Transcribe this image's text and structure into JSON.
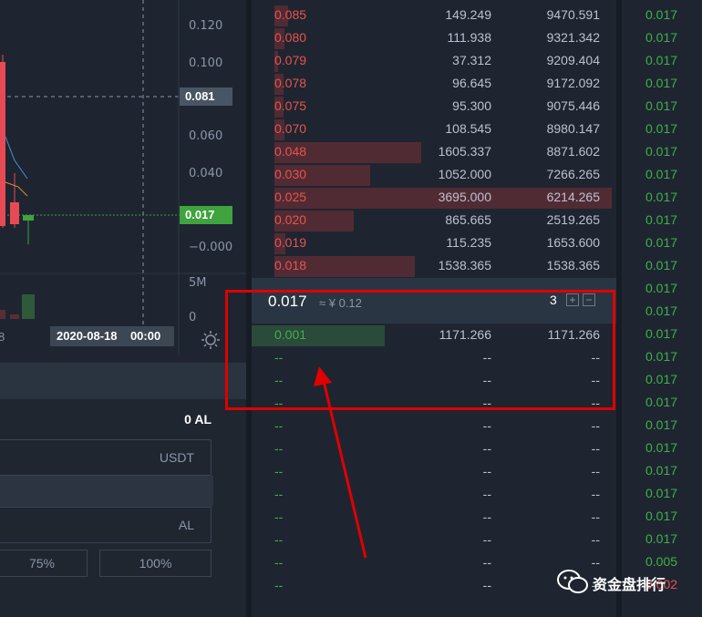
{
  "chart": {
    "y_axis_ticks": [
      "0.120",
      "0.100",
      "0.060",
      "0.040",
      "−0.000"
    ],
    "volume_ticks": [
      "5M",
      "0"
    ],
    "price_tag_last": "0.081",
    "price_tag_current": "0.017",
    "x_date_label": "2020-08-18    00:00",
    "x_partial_label": "8",
    "settings_icon": "gear-icon",
    "colors": {
      "up": "#3fa33f",
      "down": "#e84a55"
    }
  },
  "order_form": {
    "available": "0 AL",
    "price_unit": "USDT",
    "amount_unit": "AL",
    "percent_buttons": [
      "75%",
      "100%"
    ]
  },
  "order_book": {
    "asks": [
      {
        "price": "0.085",
        "amount": "149.249",
        "total": "9470.591"
      },
      {
        "price": "0.080",
        "amount": "111.938",
        "total": "9321.342"
      },
      {
        "price": "0.079",
        "amount": "37.312",
        "total": "9209.404"
      },
      {
        "price": "0.078",
        "amount": "96.645",
        "total": "9172.092"
      },
      {
        "price": "0.075",
        "amount": "95.300",
        "total": "9075.446"
      },
      {
        "price": "0.070",
        "amount": "108.545",
        "total": "8980.147"
      },
      {
        "price": "0.048",
        "amount": "1605.337",
        "total": "8871.602"
      },
      {
        "price": "0.030",
        "amount": "1052.000",
        "total": "7266.265"
      },
      {
        "price": "0.025",
        "amount": "3695.000",
        "total": "6214.265"
      },
      {
        "price": "0.020",
        "amount": "865.665",
        "total": "2519.265"
      },
      {
        "price": "0.019",
        "amount": "115.235",
        "total": "1653.600"
      },
      {
        "price": "0.018",
        "amount": "1538.365",
        "total": "1538.365"
      }
    ],
    "last_price": "0.017",
    "last_price_cny": "≈ ¥ 0.12",
    "depth_level": "3",
    "depth_plus": "+",
    "depth_minus": "−",
    "bids": [
      {
        "price": "0.001",
        "amount": "1171.266",
        "total": "1171.266"
      }
    ],
    "empty_placeholder": "--",
    "empty_rows": 11
  },
  "trades": [
    "0.017",
    "0.017",
    "0.017",
    "0.017",
    "0.017",
    "0.017",
    "0.017",
    "0.017",
    "0.017",
    "0.017",
    "0.017",
    "0.017",
    "0.017",
    "0.017",
    "0.017",
    "0.017",
    "0.017",
    "0.017",
    "0.017",
    "0.017",
    "0.017",
    "0.017",
    "0.017",
    "0.017",
    "0.005",
    "0.002"
  ],
  "trade_colors": {
    "up": "#3fb04a",
    "down": "#e8534d"
  },
  "annotation": {
    "color": "#e00000"
  },
  "watermark": {
    "text": "资金盘排行",
    "icon": "wechat-icon"
  }
}
